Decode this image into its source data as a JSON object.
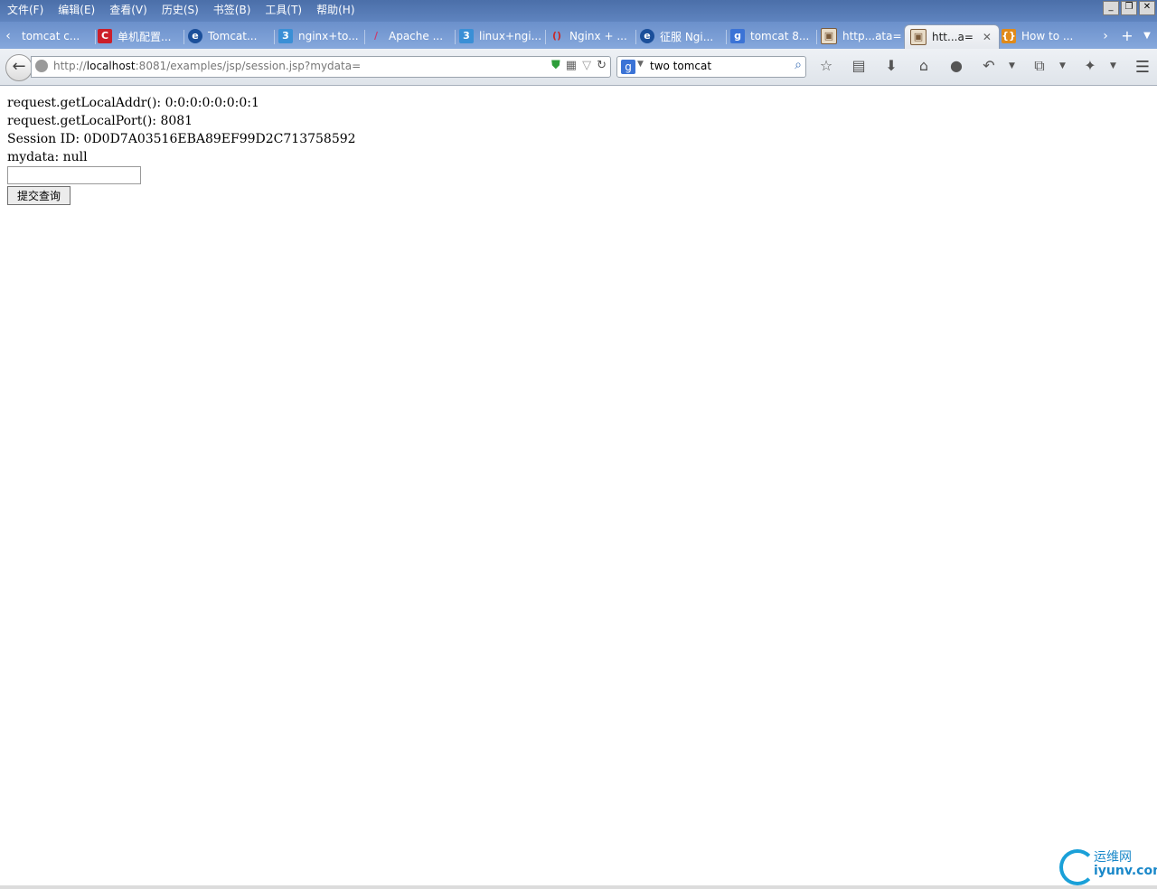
{
  "menu": [
    "文件(F)",
    "编辑(E)",
    "查看(V)",
    "历史(S)",
    "书签(B)",
    "工具(T)",
    "帮助(H)"
  ],
  "window_controls": [
    "minimize",
    "restore",
    "close"
  ],
  "tabs": [
    {
      "label": "tomcat c...",
      "icon": "blank",
      "color": "#ffffff"
    },
    {
      "label": "单机配置...",
      "icon": "c-logo",
      "color": "#cc1f2a"
    },
    {
      "label": "Tomcat...",
      "icon": "e-logo",
      "color": "#1b4f9a"
    },
    {
      "label": "nginx+to...",
      "icon": "s-logo",
      "color": "#3a8fd6"
    },
    {
      "label": "Apache ...",
      "icon": "feather",
      "color": "#c83b6f"
    },
    {
      "label": "linux+ngi...",
      "icon": "s-logo",
      "color": "#3a8fd6"
    },
    {
      "label": "Nginx + ...",
      "icon": "bracket",
      "color": "#c92a2a"
    },
    {
      "label": "征服 Ngi...",
      "icon": "e-logo",
      "color": "#1b4f9a"
    },
    {
      "label": "tomcat 8...",
      "icon": "google",
      "color": "#3b73d6"
    },
    {
      "label": "http...ata=",
      "icon": "image",
      "color": "#7a5a3a"
    },
    {
      "label": "htt...a=",
      "icon": "image",
      "color": "#7a5a3a",
      "active": true
    },
    {
      "label": "How to ...",
      "icon": "brackets",
      "color": "#e08a1a"
    }
  ],
  "url": {
    "prefix": "http://",
    "host": "localhost",
    "rest": ":8081/examples/jsp/session.jsp?mydata="
  },
  "search": {
    "engine": "g",
    "query": "two tomcat"
  },
  "page": {
    "lines": [
      "request.getLocalAddr(): 0:0:0:0:0:0:0:1",
      "request.getLocalPort(): 8081",
      "Session ID: 0D0D7A03516EBA89EF99D2C713758592",
      "mydata: null"
    ],
    "submit_label": "提交查询",
    "input_value": ""
  },
  "watermark": {
    "top": "运维网",
    "bottom": "iyunv.com"
  }
}
